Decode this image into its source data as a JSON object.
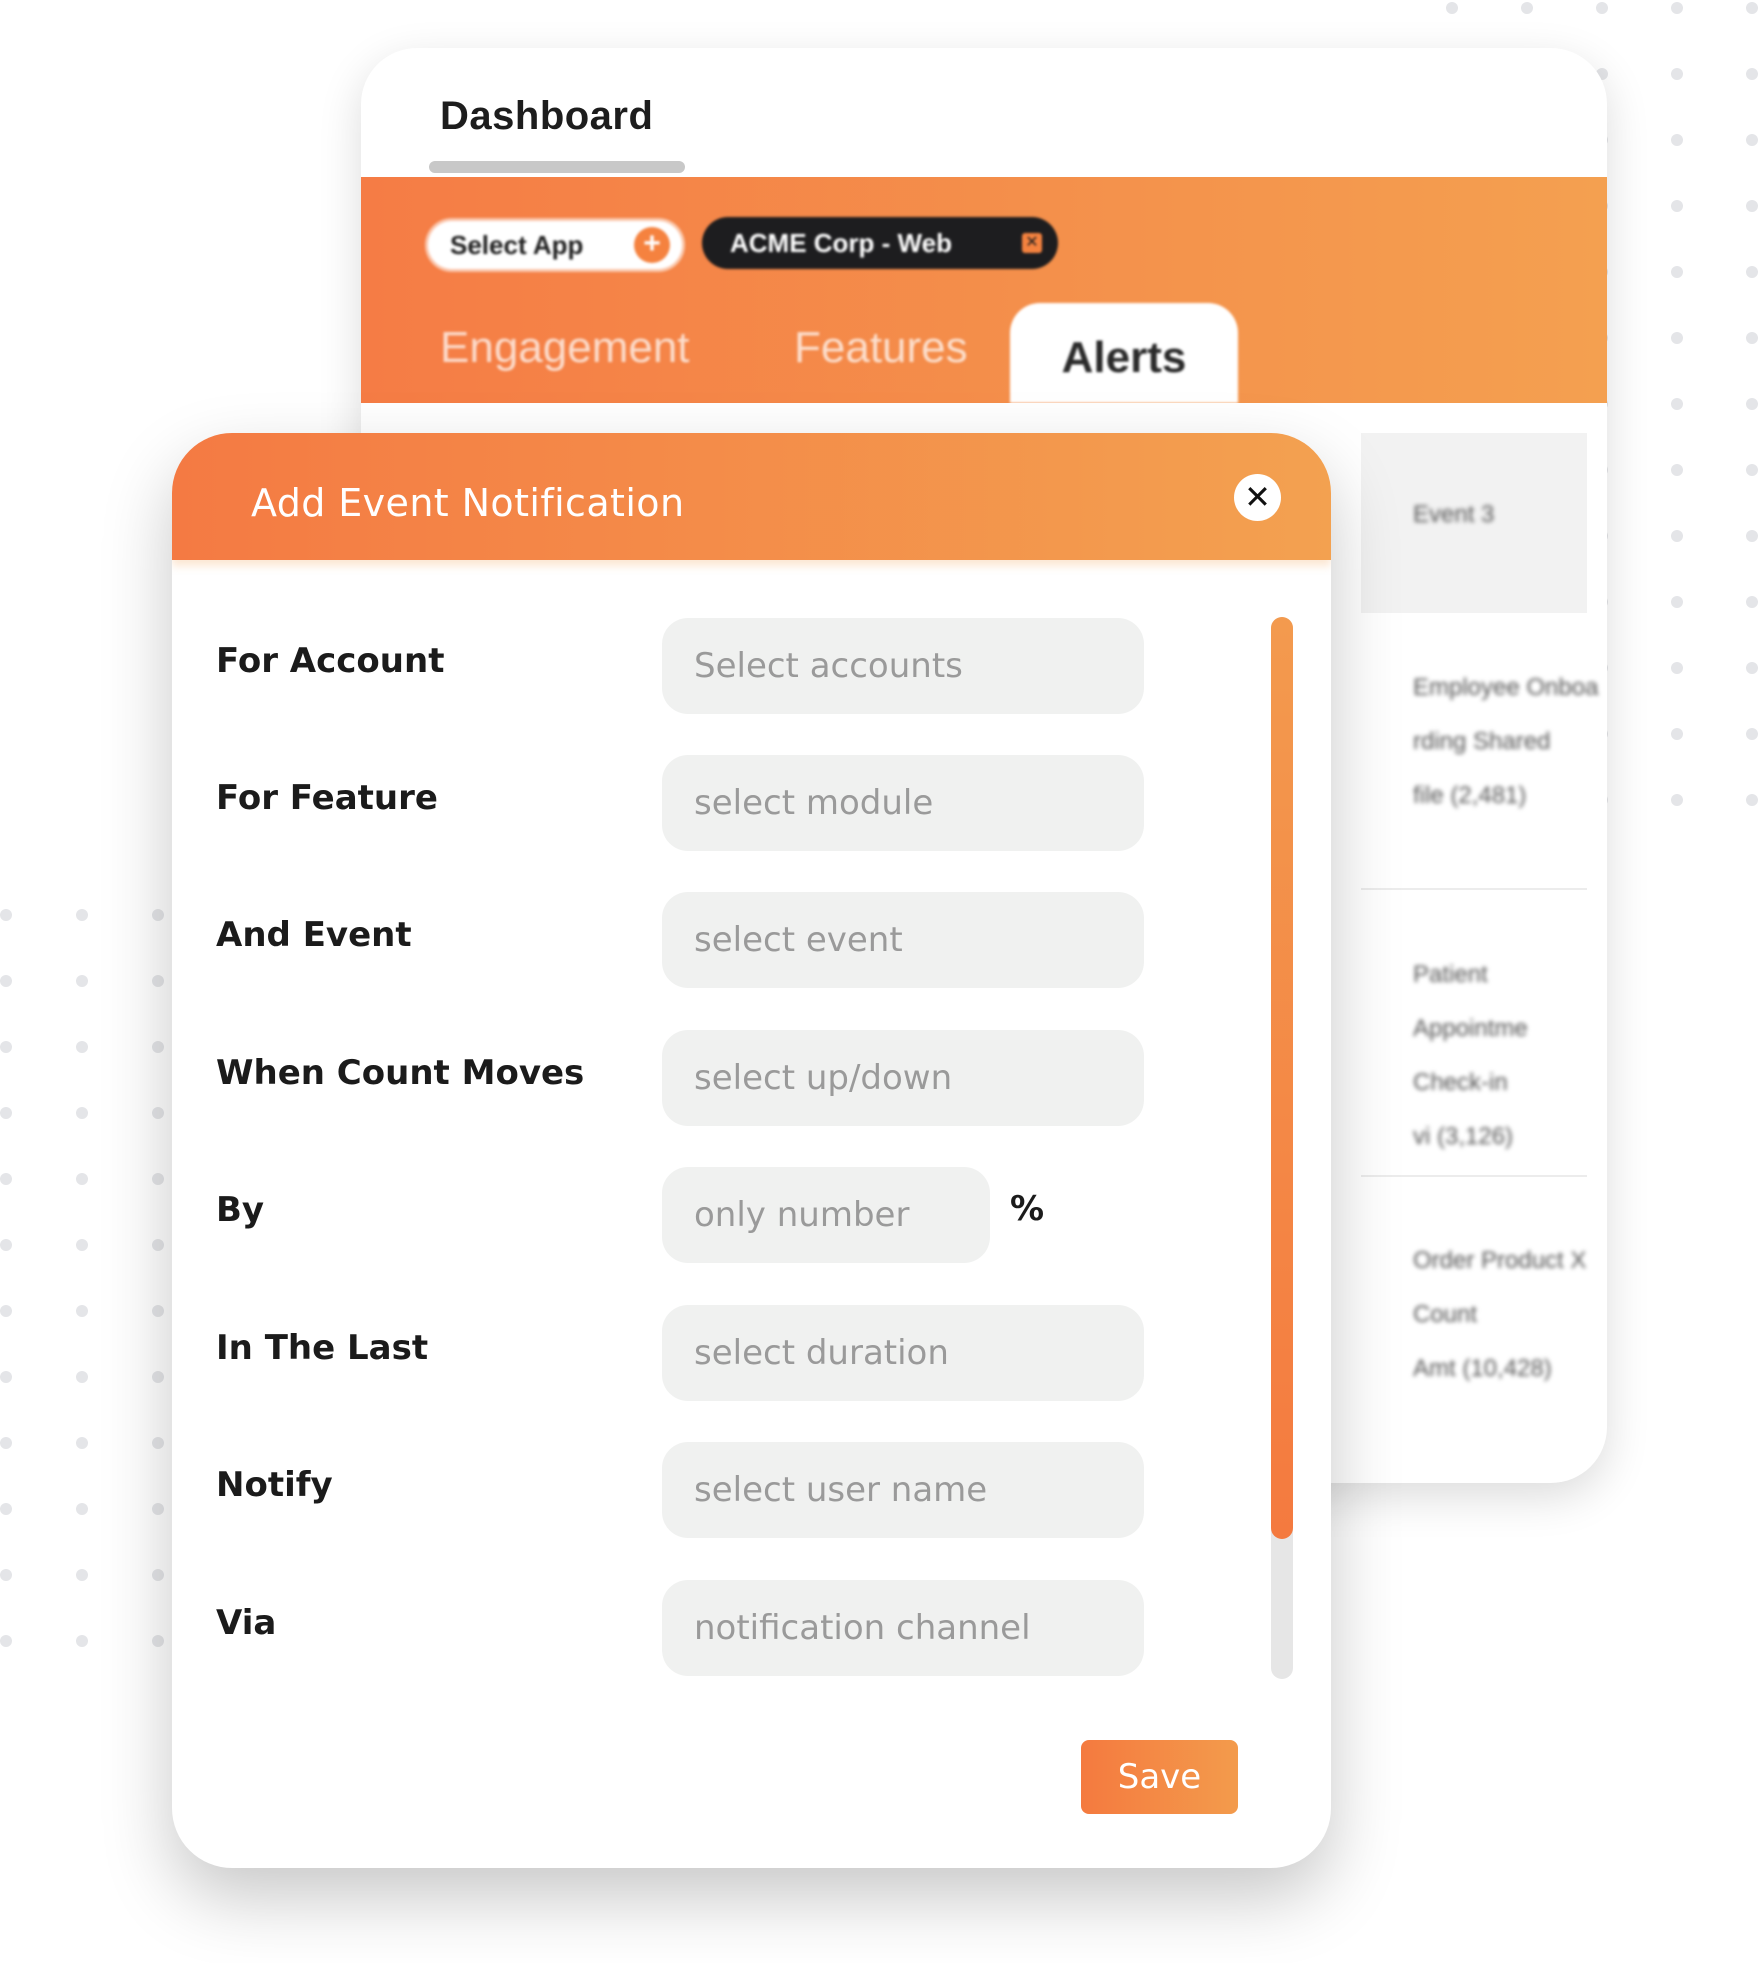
{
  "dashboard": {
    "title": "Dashboard",
    "select_app_label": "Select App",
    "app_chip_label": "ACME Corp - Web",
    "tabs": [
      {
        "label": "Engagement"
      },
      {
        "label": "Features"
      },
      {
        "label": "Alerts"
      }
    ],
    "active_tab": "Alerts",
    "table_header": "Event 3",
    "table_cells": [
      "Employee Onboa\nrding Shared\nfile (2,481)",
      "Patient Appointme\nCheck-in\nvi (3,126)",
      "Order Product X\nCount\nAmt (10,428)"
    ]
  },
  "modal": {
    "title": "Add Event Notification",
    "close_label": "✕",
    "rows": [
      {
        "label": "For Account",
        "placeholder": "Select accounts"
      },
      {
        "label": "For Feature",
        "placeholder": "select module"
      },
      {
        "label": "And Event",
        "placeholder": "select event"
      },
      {
        "label": "When Count Moves",
        "placeholder": "select up/down"
      },
      {
        "label": "By",
        "placeholder": "only number",
        "suffix": "%"
      },
      {
        "label": "In The Last",
        "placeholder": "select duration"
      },
      {
        "label": "Notify",
        "placeholder": "select user name"
      },
      {
        "label": "Via",
        "placeholder": "notification channel"
      }
    ],
    "save_label": "Save"
  },
  "colors": {
    "accent_start": "#f47a43",
    "accent_end": "#f3a150",
    "chip_dark": "#1d1d1f",
    "field_bg": "#f0f1f0"
  }
}
